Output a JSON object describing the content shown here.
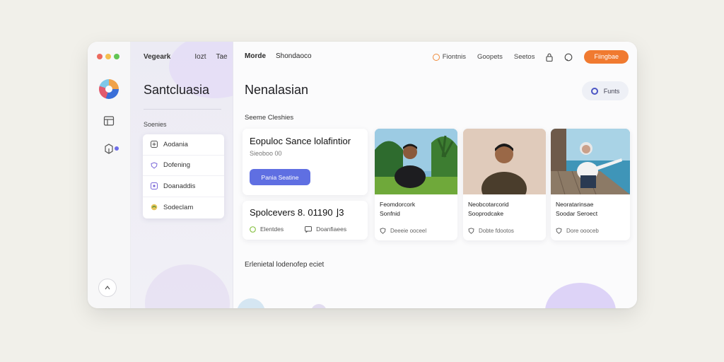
{
  "window": {
    "traffic_lights": [
      "#ec6a5e",
      "#f4bf4f",
      "#61c554"
    ]
  },
  "rail": {
    "icons": [
      "app-logo",
      "layout-icon",
      "box-icon",
      "chevron-up-icon"
    ]
  },
  "sidebar": {
    "tabs": [
      "Vegeark",
      "Iozt",
      "Tae"
    ],
    "title": "Santcluasia",
    "section": "Soenies",
    "items": [
      {
        "label": "Aodania",
        "icon": "plus-square-icon"
      },
      {
        "label": "Dofening",
        "icon": "shield-icon"
      },
      {
        "label": "Doanaddis",
        "icon": "square-dot-icon"
      },
      {
        "label": "Sodeclam",
        "icon": "leaf-icon"
      }
    ]
  },
  "topnav": {
    "links": [
      "Morde",
      "Shondaoco"
    ]
  },
  "topright": {
    "item1": "Fiontnis",
    "item2": "Goopets",
    "item3": "Seetos",
    "cta": "Fiingbae"
  },
  "main": {
    "title": "Nenalasian",
    "pill": "Funts",
    "section_label": "Seeme Cleshies",
    "card1": {
      "title": "Eopuloc Sance lolafintior",
      "sub": "Sieoboo  00",
      "button": "Pania Seatine"
    },
    "card2": {
      "stat": "Spolcevers  8.  01190  ⌋3",
      "foot1": "Elentdes",
      "foot2": "Doanfiaees"
    },
    "people": [
      {
        "line1": "Feomdorcork",
        "line2": "Sonfnid",
        "footer": "Deeeie ooceel"
      },
      {
        "line1": "Neobcotarcorid",
        "line2": "Sooprodcake",
        "footer": "Dobte fdootos"
      },
      {
        "line1": "Neoratarinsae",
        "line2": "Soodar Seroect",
        "footer": "Dore oooceb"
      }
    ],
    "bottom_label": "Erlenietal lodenofep eciet"
  }
}
